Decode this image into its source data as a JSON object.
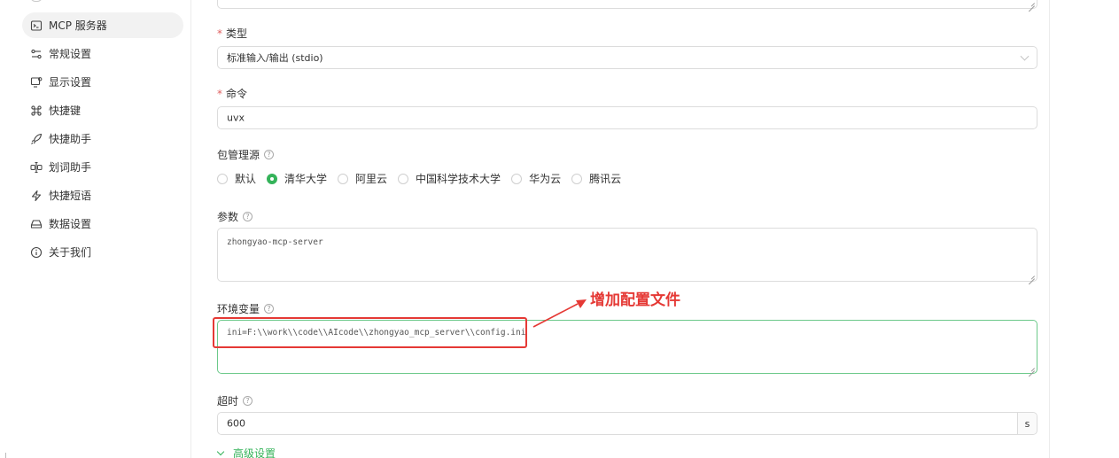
{
  "sidebar": {
    "items": [
      {
        "label": "MCP 服务器",
        "icon": "terminal-icon",
        "active": true
      },
      {
        "label": "常规设置",
        "icon": "sliders-icon",
        "active": false
      },
      {
        "label": "显示设置",
        "icon": "monitor-icon",
        "active": false
      },
      {
        "label": "快捷键",
        "icon": "command-icon",
        "active": false
      },
      {
        "label": "快捷助手",
        "icon": "rocket-icon",
        "active": false
      },
      {
        "label": "划词助手",
        "icon": "text-select-icon",
        "active": false
      },
      {
        "label": "快捷短语",
        "icon": "zap-icon",
        "active": false
      },
      {
        "label": "数据设置",
        "icon": "database-icon",
        "active": false
      },
      {
        "label": "关于我们",
        "icon": "info-icon",
        "active": false
      }
    ]
  },
  "form": {
    "type": {
      "required_mark": "*",
      "label": "类型",
      "value": "标准输入/输出 (stdio)"
    },
    "command": {
      "required_mark": "*",
      "label": "命令",
      "value": "uvx"
    },
    "package_source": {
      "label": "包管理源",
      "options": [
        {
          "label": "默认",
          "checked": false
        },
        {
          "label": "清华大学",
          "checked": true
        },
        {
          "label": "阿里云",
          "checked": false
        },
        {
          "label": "中国科学技术大学",
          "checked": false
        },
        {
          "label": "华为云",
          "checked": false
        },
        {
          "label": "腾讯云",
          "checked": false
        }
      ]
    },
    "args": {
      "label": "参数",
      "value": "zhongyao-mcp-server"
    },
    "env": {
      "label": "环境变量",
      "value": "ini=F:\\\\work\\\\code\\\\AIcode\\\\zhongyao_mcp_server\\\\config.ini"
    },
    "timeout": {
      "label": "超时",
      "value": "600",
      "unit": "s"
    },
    "advanced": {
      "label": "高级设置"
    }
  },
  "annotation": {
    "text": "增加配置文件",
    "color": "#e53935"
  },
  "colors": {
    "accent": "#35b35a",
    "required": "#e06060",
    "border": "#dcdcdc",
    "active_bg": "#f2f2f2"
  }
}
